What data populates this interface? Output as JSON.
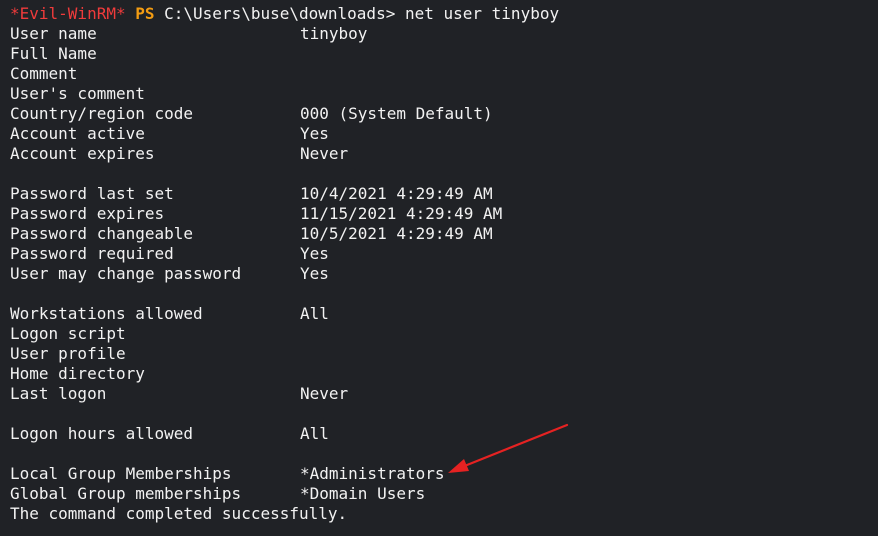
{
  "terminal": {
    "prompt": {
      "shell_name": "*Evil-WinRM*",
      "ps_label": "PS",
      "path": "C:\\Users\\buse\\downloads>",
      "command": "net user tinyboy"
    },
    "fields": [
      {
        "label": "User name",
        "value": "tinyboy"
      },
      {
        "label": "Full Name",
        "value": ""
      },
      {
        "label": "Comment",
        "value": ""
      },
      {
        "label": "User's comment",
        "value": ""
      },
      {
        "label": "Country/region code",
        "value": "000 (System Default)"
      },
      {
        "label": "Account active",
        "value": "Yes"
      },
      {
        "label": "Account expires",
        "value": "Never"
      },
      {
        "label": "",
        "value": ""
      },
      {
        "label": "Password last set",
        "value": "10/4/2021 4:29:49 AM"
      },
      {
        "label": "Password expires",
        "value": "11/15/2021 4:29:49 AM"
      },
      {
        "label": "Password changeable",
        "value": "10/5/2021 4:29:49 AM"
      },
      {
        "label": "Password required",
        "value": "Yes"
      },
      {
        "label": "User may change password",
        "value": "Yes"
      },
      {
        "label": "",
        "value": ""
      },
      {
        "label": "Workstations allowed",
        "value": "All"
      },
      {
        "label": "Logon script",
        "value": ""
      },
      {
        "label": "User profile",
        "value": ""
      },
      {
        "label": "Home directory",
        "value": ""
      },
      {
        "label": "Last logon",
        "value": "Never"
      },
      {
        "label": "",
        "value": ""
      },
      {
        "label": "Logon hours allowed",
        "value": "All"
      },
      {
        "label": "",
        "value": ""
      },
      {
        "label": "Local Group Memberships",
        "value": "*Administrators"
      },
      {
        "label": "Global Group memberships",
        "value": "*Domain Users"
      }
    ],
    "completion_message": "The command completed successfully."
  },
  "colors": {
    "background": "#202226",
    "text": "#f2f2f2",
    "evil_prompt": "#ef3b3b",
    "ps_prompt": "#f39c12",
    "annotation_arrow": "#e52222"
  }
}
